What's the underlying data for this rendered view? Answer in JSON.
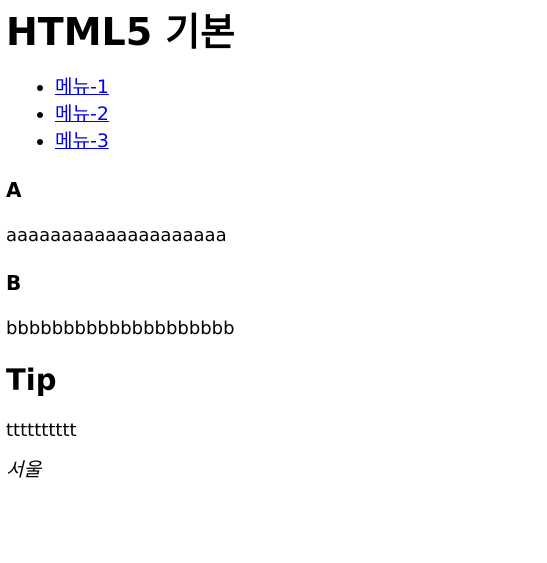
{
  "page": {
    "title": "HTML5 기본",
    "menu": [
      {
        "label": "메뉴-1"
      },
      {
        "label": "메뉴-2"
      },
      {
        "label": "메뉴-3"
      }
    ],
    "sections": [
      {
        "heading": "A",
        "text": "aaaaaaaaaaaaaaaaaaaa"
      },
      {
        "heading": "B",
        "text": "bbbbbbbbbbbbbbbbbbbb"
      }
    ],
    "tip": {
      "heading": "Tip",
      "text": "tttttttttt"
    },
    "address": "서울",
    "colors": {
      "link": "#0000ee",
      "text": "#000000",
      "background": "#ffffff"
    }
  }
}
